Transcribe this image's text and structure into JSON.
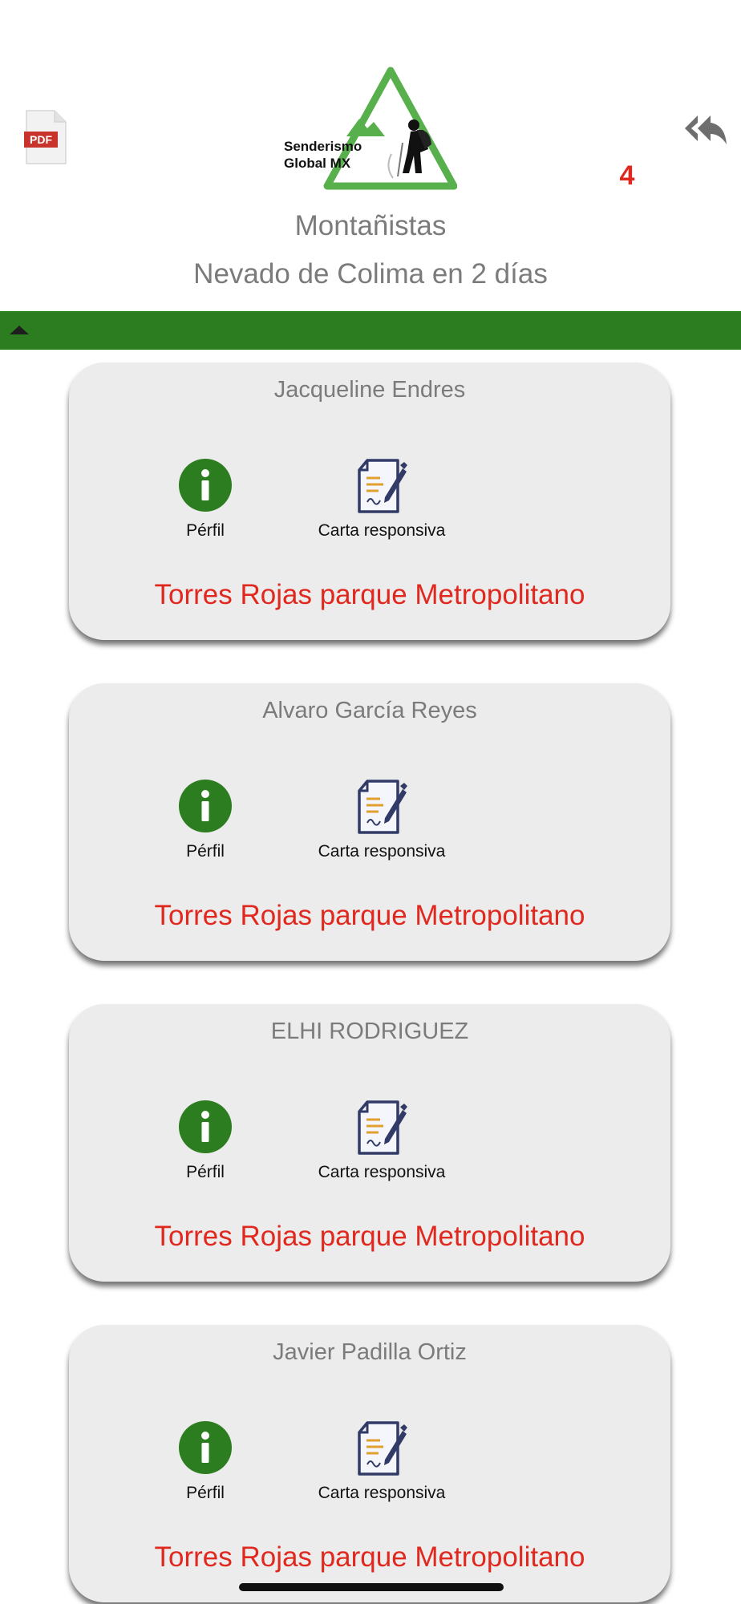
{
  "header": {
    "pdf_label": "PDF",
    "count": "4",
    "logo_line1": "Senderismo",
    "logo_line2": "Global MX",
    "title": "Montañistas",
    "subtitle": "Nevado de Colima en 2 días"
  },
  "colors": {
    "accent_green": "#2c7d1f",
    "alert_red": "#e0281e",
    "card_bg": "#ececec",
    "muted_text": "#7b7b7b"
  },
  "icons": {
    "pdf": "pdf-file-icon",
    "back": "reply-all-icon",
    "toggle": "caret-up-icon",
    "profile": "info-icon",
    "letter": "signed-document-icon"
  },
  "participants": [
    {
      "name": "Jacqueline  Endres",
      "profile_label": "Pérfil",
      "letter_label": "Carta responsiva",
      "location": "Torres Rojas parque Metropolitano"
    },
    {
      "name": "Alvaro García Reyes",
      "profile_label": "Pérfil",
      "letter_label": "Carta responsiva",
      "location": "Torres Rojas parque Metropolitano"
    },
    {
      "name": "ELHI RODRIGUEZ",
      "profile_label": "Pérfil",
      "letter_label": "Carta responsiva",
      "location": "Torres Rojas parque Metropolitano"
    },
    {
      "name": "Javier Padilla Ortiz",
      "profile_label": "Pérfil",
      "letter_label": "Carta responsiva",
      "location": "Torres Rojas parque Metropolitano"
    }
  ]
}
